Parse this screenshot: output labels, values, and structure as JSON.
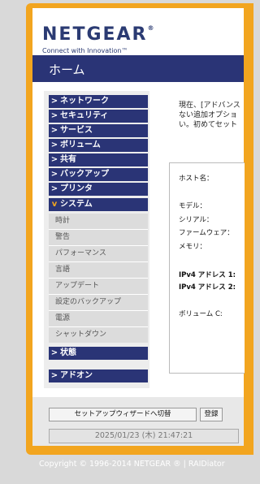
{
  "header": {
    "logo": "NETGEAR",
    "logo_reg": "®",
    "tagline": "Connect with Innovation™"
  },
  "page_title": "ホーム",
  "sidebar": {
    "items": [
      {
        "label": "ネットワーク",
        "expanded": false
      },
      {
        "label": "セキュリティ",
        "expanded": false
      },
      {
        "label": "サービス",
        "expanded": false
      },
      {
        "label": "ボリューム",
        "expanded": false
      },
      {
        "label": "共有",
        "expanded": false
      },
      {
        "label": "バックアップ",
        "expanded": false
      },
      {
        "label": "プリンタ",
        "expanded": false
      },
      {
        "label": "システム",
        "expanded": true
      }
    ],
    "system_subitems": [
      "時計",
      "警告",
      "パフォーマンス",
      "言語",
      "アップデート",
      "設定のバックアップ",
      "電源",
      "シャットダウン"
    ],
    "status": "状態",
    "addons": "アドオン"
  },
  "main": {
    "intro_lines": [
      "現在、[アドバンス",
      "ない追加オプショ",
      "い。初めてセット"
    ],
    "labels": {
      "host": "ホスト名：",
      "model": "モデル：",
      "serial": "シリアル：",
      "firmware": "ファームウェア：",
      "memory": "メモリ：",
      "ipv4_1": "IPv4 アドレス 1:",
      "ipv4_2": "IPv4 アドレス 2:",
      "volume": "ボリューム C:"
    }
  },
  "bottom": {
    "wizard_button": "セットアップウィザードへ切替",
    "register_button": "登録",
    "clock": "2025/01/23 (木) 21:47:21"
  },
  "footer": "Copyright © 1996-2014 NETGEAR ® | RAIDiator"
}
